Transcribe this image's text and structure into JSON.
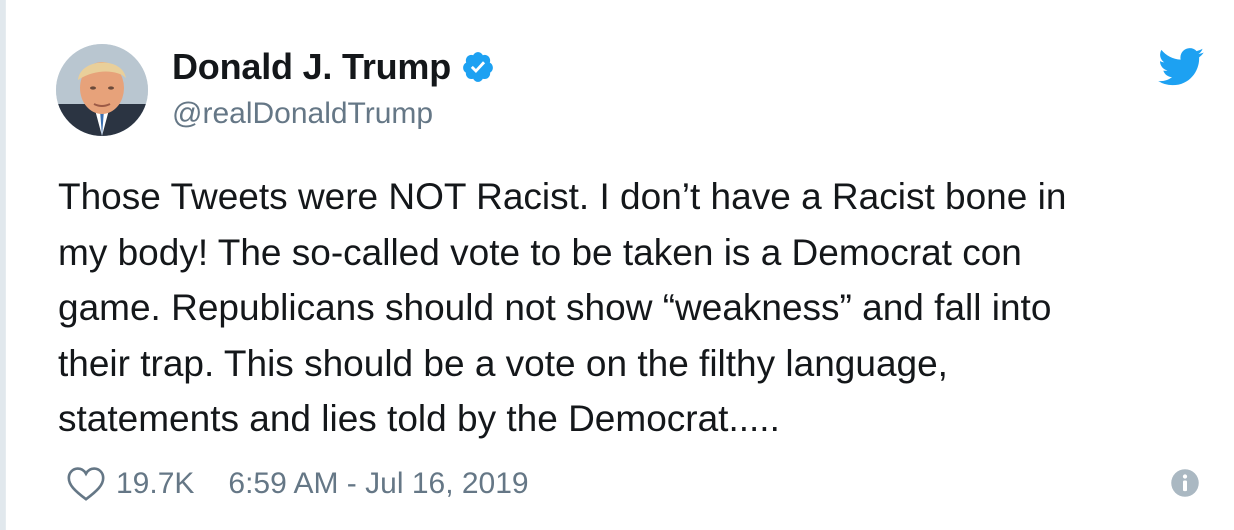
{
  "tweet": {
    "author": {
      "display_name": "Donald J. Trump",
      "handle": "@realDonaldTrump",
      "verified": true
    },
    "text": "Those Tweets were NOT Racist. I don’t have a Racist bone in\nmy body! The so-called vote to be taken is a Democrat con\ngame. Republicans should not show “weakness” and fall into\ntheir trap. This should be a vote on the filthy language,\nstatements and lies told by the Democrat.....",
    "likes": "19.7K",
    "timestamp": "6:59 AM - Jul 16, 2019"
  },
  "icons": {
    "verified": "verified-badge-icon",
    "brand": "twitter-bird-icon",
    "like": "heart-icon",
    "info": "info-icon"
  },
  "colors": {
    "brand": "#1da1f2",
    "text": "#14171a",
    "muted": "#657786",
    "info": "#aab8c2"
  }
}
